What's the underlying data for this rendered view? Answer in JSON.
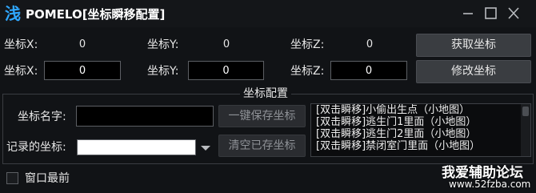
{
  "window": {
    "icon_glyph": "浅",
    "title": "POMELO[坐标瞬移配置]",
    "controls": [
      "minimize-icon",
      "maximize-icon",
      "close-icon"
    ]
  },
  "current": {
    "x_label": "坐标X:",
    "x_value": "0",
    "y_label": "坐标Y:",
    "y_value": "0",
    "z_label": "坐标Z:",
    "z_value": "0",
    "get_button": "获取坐标"
  },
  "edit": {
    "x_label": "坐标X:",
    "x_value": "0",
    "y_label": "坐标Y:",
    "y_value": "0",
    "z_label": "坐标Z:",
    "z_value": "0",
    "modify_button": "修改坐标"
  },
  "config": {
    "group_title": "坐标配置",
    "name_label": "坐标名字:",
    "name_value": "",
    "save_button": "一键保存坐标",
    "saved_label": "记录的坐标:",
    "saved_value": "",
    "clear_button": "清空已存坐标",
    "list": [
      "[双击瞬移]小偷出生点（小地图）",
      "[双击瞬移]逃生门1里面（小地图）",
      "[双击瞬移]逃生门2里面（小地图）",
      "[双击瞬移]禁闭室门里面（小地图）"
    ]
  },
  "footer": {
    "topmost_label": "窗口最前",
    "topmost_checked": false
  },
  "watermark": {
    "title": "我爱辅助论坛",
    "url": "www.52fzba.com"
  },
  "colors": {
    "background": "#111316",
    "accent": "#2fa7ff",
    "button": "#3a3d41"
  }
}
